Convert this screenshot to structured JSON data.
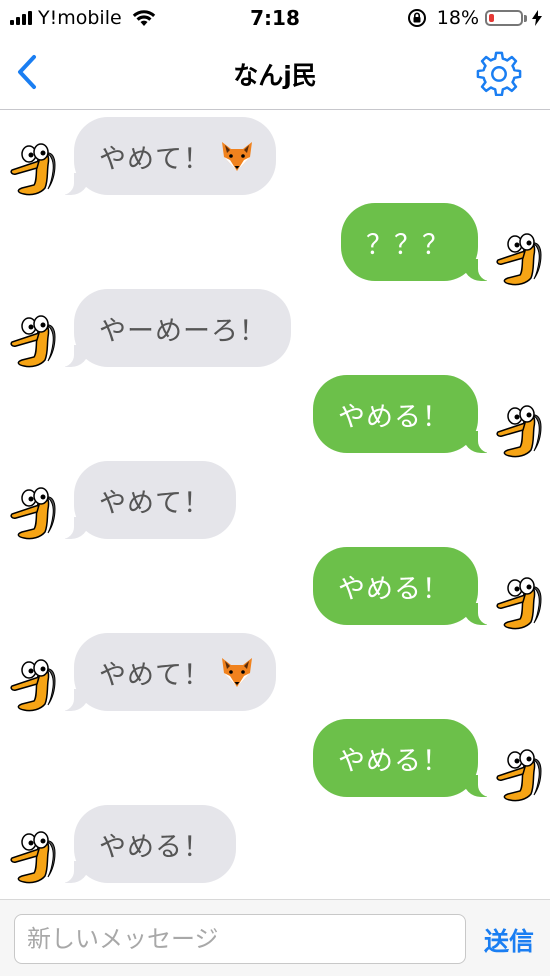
{
  "status_bar": {
    "carrier": "Y!mobile",
    "time": "7:18",
    "battery_percent": "18%",
    "battery_level": 0.18,
    "icons": [
      "signal-icon",
      "wifi-icon",
      "orientation-lock-icon",
      "battery-icon",
      "charging-bolt-icon"
    ]
  },
  "nav": {
    "title": "なんj民",
    "back_icon": "chevron-left-icon",
    "settings_icon": "gear-icon",
    "accent_color": "#1a7ef2"
  },
  "messages": [
    {
      "side": "in",
      "text": "やめて！",
      "emoji": "fox"
    },
    {
      "side": "out",
      "text": "？？？"
    },
    {
      "side": "in",
      "text": "やーめーろ！"
    },
    {
      "side": "out",
      "text": "やめる！"
    },
    {
      "side": "in",
      "text": "やめて！"
    },
    {
      "side": "out",
      "text": "やめる！"
    },
    {
      "side": "in",
      "text": "やめて！",
      "emoji": "fox"
    },
    {
      "side": "out",
      "text": "やめる！"
    },
    {
      "side": "in",
      "text": "やめる！"
    }
  ],
  "colors": {
    "incoming_bubble": "#e5e5ea",
    "outgoing_bubble": "#6cc04a"
  },
  "input": {
    "placeholder": "新しいメッセージ",
    "value": "",
    "send_label": "送信"
  }
}
